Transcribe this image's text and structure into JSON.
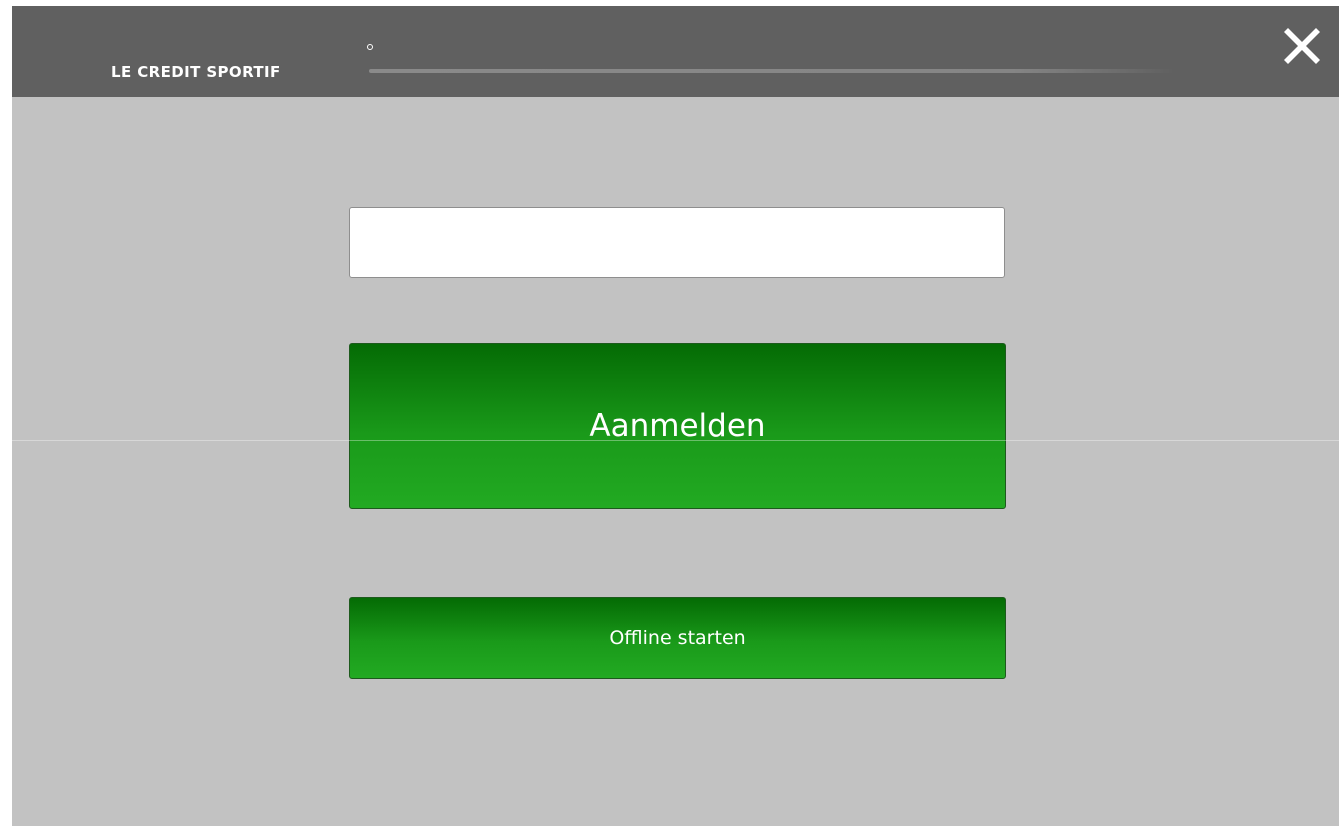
{
  "header": {
    "brand": "LE CREDIT SPORTIF",
    "close_icon": "close-icon"
  },
  "login": {
    "username_value": "",
    "login_label": "Aanmelden",
    "offline_label": "Offline starten"
  },
  "colors": {
    "titlebar": "#606060",
    "background": "#c2c2c2",
    "button_top": "#046b04",
    "button_bottom": "#22aa22",
    "button_text": "#ffffff"
  }
}
